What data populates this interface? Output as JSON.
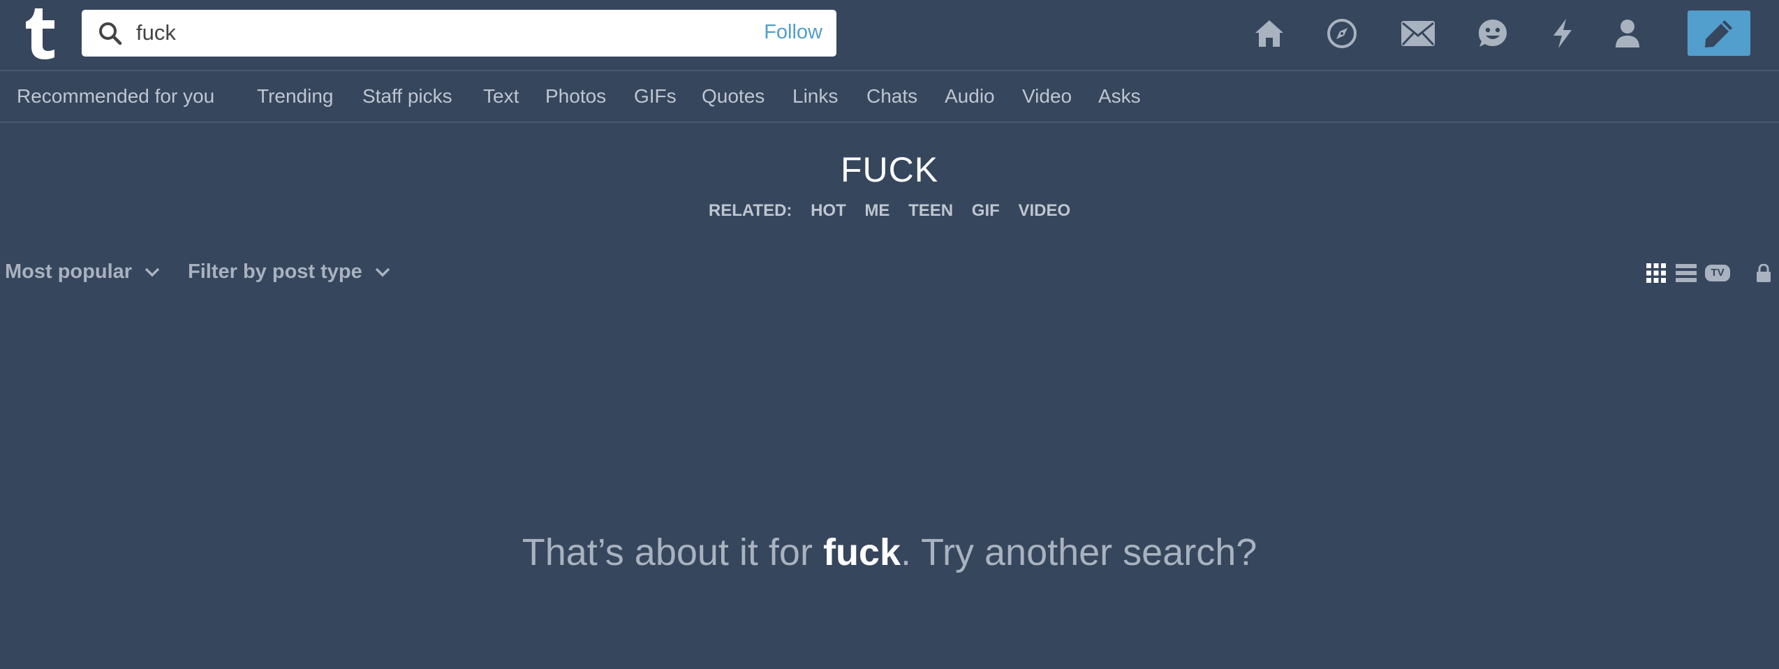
{
  "header": {
    "logo_letter": "t",
    "search": {
      "value": "fuck",
      "placeholder": "",
      "follow_label": "Follow"
    },
    "nav_icons": [
      "home-icon",
      "explore-icon",
      "inbox-icon",
      "messaging-icon",
      "activity-icon",
      "account-icon"
    ],
    "compose_icon": "pencil-icon"
  },
  "tabs": [
    "Recommended for you",
    "Trending",
    "Staff picks",
    "Text",
    "Photos",
    "GIFs",
    "Quotes",
    "Links",
    "Chats",
    "Audio",
    "Video",
    "Asks"
  ],
  "title": "FUCK",
  "related": {
    "label": "RELATED:",
    "items": [
      "HOT",
      "ME",
      "TEEN",
      "GIF",
      "VIDEO"
    ]
  },
  "filters": {
    "sort_label": "Most popular",
    "post_type_label": "Filter by post type"
  },
  "view_icons": [
    "grid-view-icon",
    "list-view-icon",
    "tv-view-icon",
    "lock-icon"
  ],
  "tv_label": "TV",
  "empty_message": {
    "prefix": "That’s about it for ",
    "term": "fuck",
    "suffix": ". Try another search?"
  },
  "colors": {
    "background": "#36465d",
    "accent": "#529ecc",
    "muted_text": "#a9b2bf",
    "nav_icon": "#a9b2bf"
  }
}
